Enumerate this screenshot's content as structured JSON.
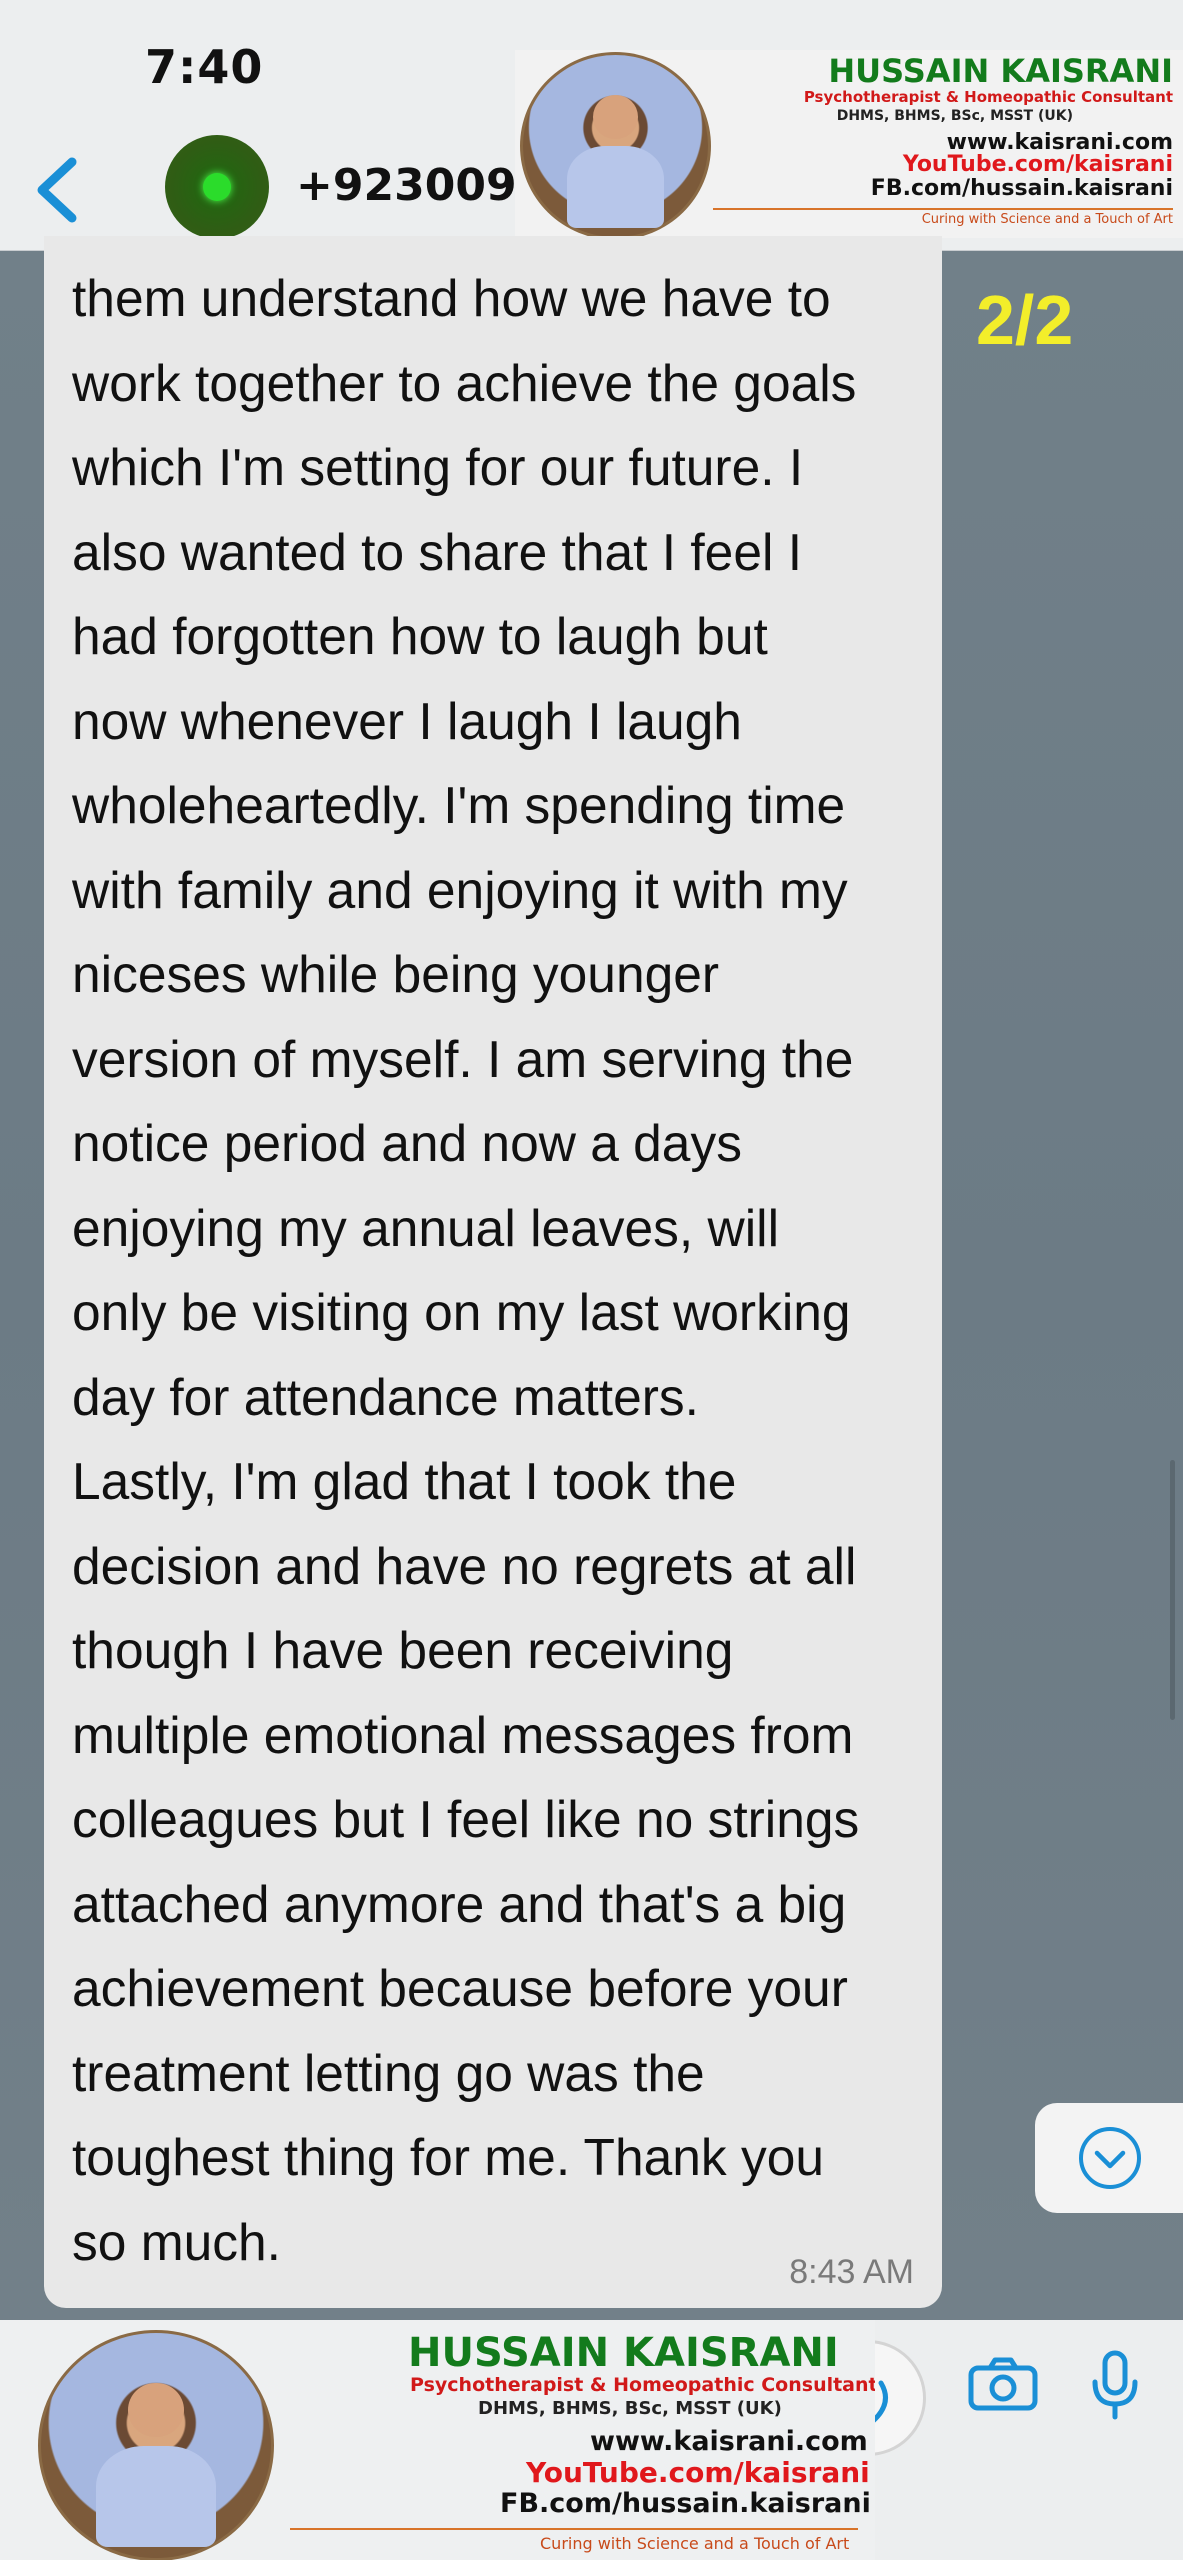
{
  "status_bar": {
    "time": "7:40"
  },
  "header": {
    "contact": "+9230094",
    "icons": {
      "back": "chevron-left-icon",
      "avatar": "avatar"
    }
  },
  "watermark": {
    "name": "HUSSAIN KAISRANI",
    "role": "Psychotherapist & Homeopathic Consultant",
    "degrees": "DHMS, BHMS, BSc, MSST (UK)",
    "website": "www.kaisrani.com",
    "youtube": "YouTube.com/kaisrani",
    "facebook": "FB.com/hussain.kaisrani",
    "tagline": "Curing with Science and a Touch of Art"
  },
  "page_counter": "2/2",
  "message": {
    "text": "them understand how we have to\nwork together to achieve the goals\nwhich I'm setting for our future. I\nalso wanted to share that I feel I\nhad forgotten how to laugh but\nnow whenever I laugh I laugh\nwholeheartedly. I'm spending time\nwith family and enjoying it with my\nniceses while being younger\nversion of myself. I am serving the\nnotice period and now a days\nenjoying my annual leaves, will\nonly be visiting on my last working\nday for attendance matters.\nLastly, I'm glad that I took the\ndecision and have no regrets at all\nthough I have been receiving\nmultiple emotional messages from\ncolleagues but I feel like no strings\nattached anymore and that's a big\nachievement because before your\ntreatment letting go was the\ntoughest thing for me. Thank you\nso much.",
    "time": "8:43 AM"
  },
  "composer": {
    "icons": [
      "sticker-icon",
      "camera-icon",
      "microphone-icon"
    ]
  },
  "colors": {
    "accent_blue": "#1a8fd6",
    "bubble": "#e8e8e8",
    "wallpaper": "#6f7f89",
    "counter": "#f3ee2a",
    "brand_green": "#137b1c",
    "brand_red": "#d11919"
  }
}
